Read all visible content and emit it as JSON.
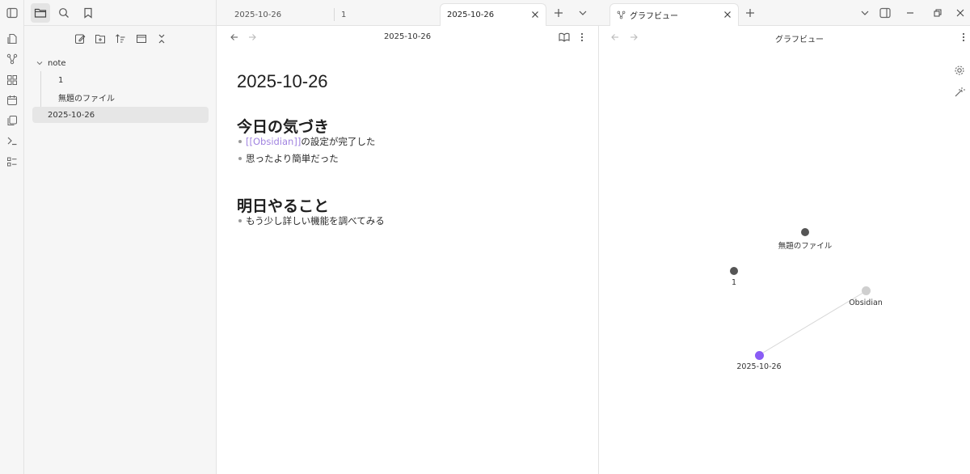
{
  "ribbon": {
    "icons": [
      "open-quick-switcher-icon",
      "graph-view-icon",
      "canvas-icon",
      "daily-note-icon",
      "templates-icon",
      "command-palette-icon",
      "bases-icon"
    ]
  },
  "sidebar": {
    "tabs": [
      "files-icon",
      "search-icon",
      "bookmark-icon"
    ],
    "toolbar": [
      "new-note-icon",
      "new-folder-icon",
      "sort-icon",
      "auto-reveal-icon",
      "collapse-all-icon"
    ],
    "tree": {
      "folder": "note",
      "children": [
        "1",
        "無題のファイル"
      ],
      "root_file": "2025-10-26"
    }
  },
  "tabs_left": [
    {
      "label": "2025-10-26"
    },
    {
      "label": "1"
    },
    {
      "label": "2025-10-26"
    }
  ],
  "tabs_right": [
    {
      "label": "グラフビュー"
    }
  ],
  "left_pane": {
    "nav_title": "2025-10-26",
    "doc": {
      "title": "2025-10-26",
      "section1": {
        "heading": "今日の気づき",
        "bullets": [
          {
            "link": "[[Obsidian]]",
            "rest": "の設定が完了した"
          },
          {
            "text": "思ったより簡単だった"
          }
        ]
      },
      "section2": {
        "heading": "明日やること",
        "bullets": [
          {
            "text": "もう少し詳しい機能を調べてみる"
          }
        ]
      }
    }
  },
  "right_pane": {
    "nav_title": "グラフビュー",
    "graph": {
      "nodes": [
        {
          "label": "無題のファイル",
          "color": "#555555"
        },
        {
          "label": "1",
          "color": "#555555"
        },
        {
          "label": "Obsidian",
          "color": "#cfcfcf"
        },
        {
          "label": "2025-10-26",
          "color": "#8a5cf5"
        }
      ],
      "edges": [
        [
          "2025-10-26",
          "Obsidian"
        ]
      ]
    }
  },
  "colors": {
    "accent": "#8a5cf5",
    "link": "#a184e0"
  }
}
